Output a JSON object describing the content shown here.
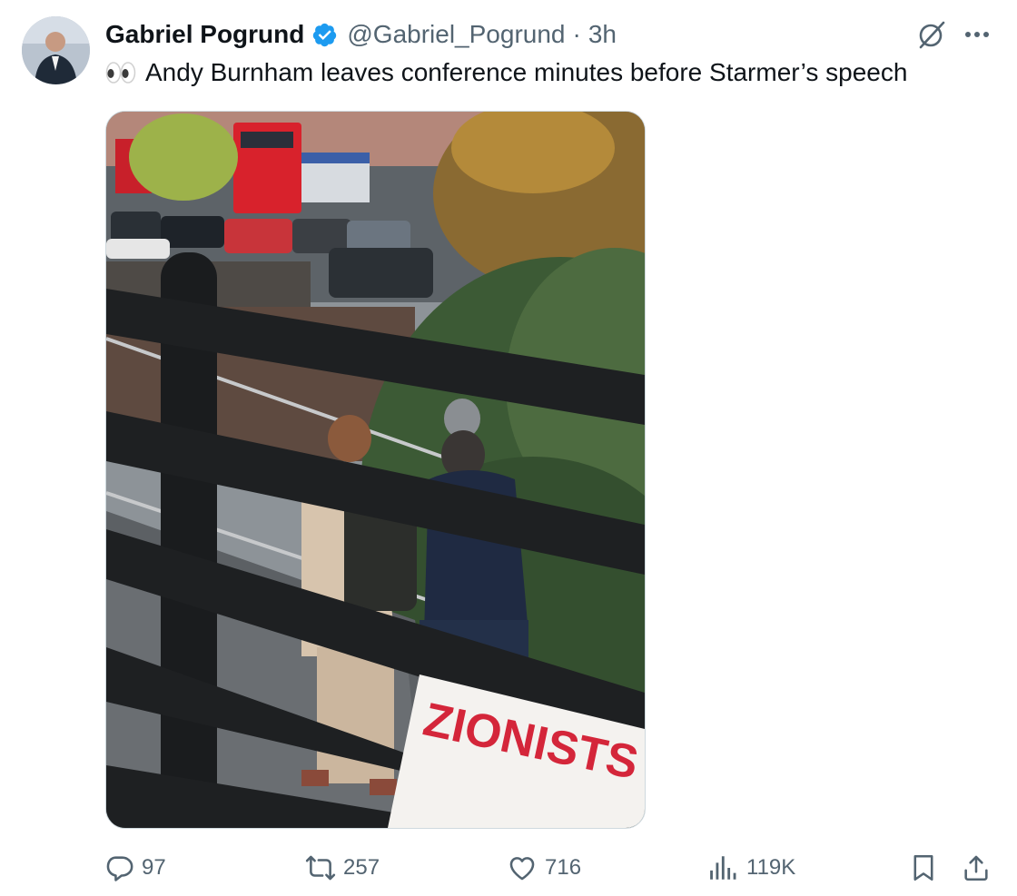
{
  "author": {
    "display_name": "Gabriel Pogrund",
    "handle": "@Gabriel_Pogrund",
    "separator": "·",
    "time": "3h",
    "verified_icon": "verified-badge-icon",
    "avatar_icon": "avatar"
  },
  "tweet": {
    "emoji_icon": "eyes-emoji-icon",
    "text": "Andy Burnham leaves conference minutes before Starmer’s speech"
  },
  "media": {
    "sign_text": "ZIONISTS"
  },
  "actions": {
    "replies": "97",
    "retweets": "257",
    "likes": "716",
    "views": "119K"
  },
  "colors": {
    "verified": "#1d9bf0",
    "text_primary": "#0f1419",
    "text_secondary": "#536471"
  }
}
